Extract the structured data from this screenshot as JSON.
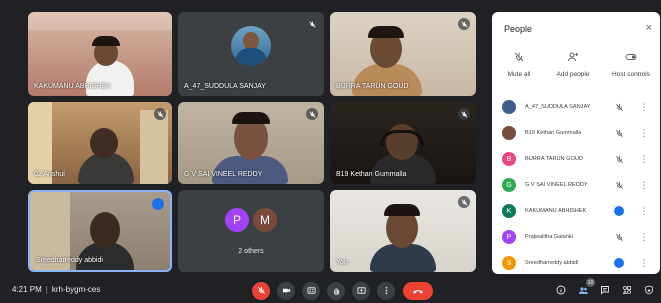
{
  "tiles": [
    {
      "name": "KAKUMANU ABHISHEK",
      "muted": false
    },
    {
      "name": "A_47_SUDDULA SANJAY",
      "muted": true
    },
    {
      "name": "BURRA TARUN GOUD",
      "muted": true
    },
    {
      "name": "02 Anshul",
      "muted": true
    },
    {
      "name": "G V SAI VINEEL REDDY",
      "muted": true
    },
    {
      "name": "B19 Kethan Gummalla",
      "muted": true
    },
    {
      "name": "Sreedharreddy abbidi",
      "muted": false,
      "speaking": true
    },
    {
      "name": "2 others",
      "avatars": [
        "P",
        "M"
      ],
      "muted": false
    },
    {
      "name": "You",
      "muted": true
    }
  ],
  "toolbar": {
    "time": "4:21 PM",
    "separator": "|",
    "meeting_code": "krh-bygm-ces",
    "participant_count": "10"
  },
  "panel": {
    "title": "People",
    "close": "×",
    "actions": [
      {
        "label": "Mute all",
        "icon": "mic-off-icon"
      },
      {
        "label": "Add people",
        "icon": "add-person-icon"
      },
      {
        "label": "Host controls",
        "icon": "toggle-icon"
      }
    ],
    "participants": [
      {
        "name": "A_47_SUDDULA SANJAY",
        "initial": "",
        "color": "#3b5f8a",
        "state": "muted"
      },
      {
        "name": "B19 Kethan Gummalla",
        "initial": "",
        "color": "#7a4a3a",
        "state": "muted"
      },
      {
        "name": "BURRA TARUN GOUD",
        "initial": "B",
        "color": "#e8467c",
        "state": "muted"
      },
      {
        "name": "G V SAI VINEEL REDDY",
        "initial": "G",
        "color": "#33a852",
        "state": "muted"
      },
      {
        "name": "KAKUMANU ABHISHEK",
        "initial": "K",
        "color": "#0b7a5a",
        "state": "active"
      },
      {
        "name": "Prajwalitha Galanki",
        "initial": "P",
        "color": "#a142f4",
        "state": "muted"
      },
      {
        "name": "Sreedharreddy abbidi",
        "initial": "S",
        "color": "#f29900",
        "state": "speaking"
      }
    ]
  },
  "colors": {
    "accent": "#1a73e8",
    "end_call": "#ea4335",
    "background": "#202124"
  }
}
